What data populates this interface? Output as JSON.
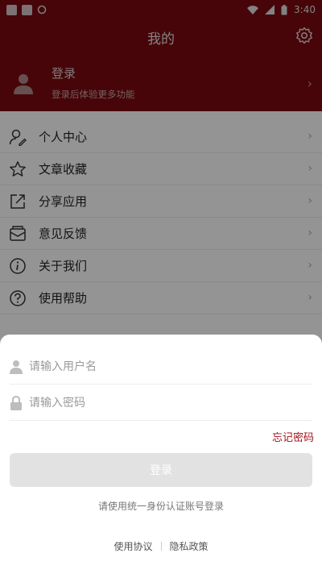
{
  "status_bar": {
    "time": "3:40"
  },
  "header": {
    "title": "我的"
  },
  "profile": {
    "login_label": "登录",
    "login_subtitle": "登录后体验更多功能"
  },
  "menu": {
    "items": [
      {
        "label": "个人中心",
        "icon": "person-edit-icon"
      },
      {
        "label": "文章收藏",
        "icon": "star-icon"
      },
      {
        "label": "分享应用",
        "icon": "share-icon"
      },
      {
        "label": "意见反馈",
        "icon": "mail-icon"
      },
      {
        "label": "关于我们",
        "icon": "info-icon"
      },
      {
        "label": "使用帮助",
        "icon": "help-icon"
      }
    ]
  },
  "login_sheet": {
    "username_placeholder": "请输入用户名",
    "password_placeholder": "请输入密码",
    "forgot_password": "忘记密码",
    "login_button": "登录",
    "unified_login_text": "请使用统一身份认证账号登录",
    "terms_link": "使用协议",
    "privacy_link": "隐私政策"
  },
  "colors": {
    "brand": "#7a0a10",
    "accent": "#a5101a",
    "button_disabled": "#e2e2e2"
  }
}
